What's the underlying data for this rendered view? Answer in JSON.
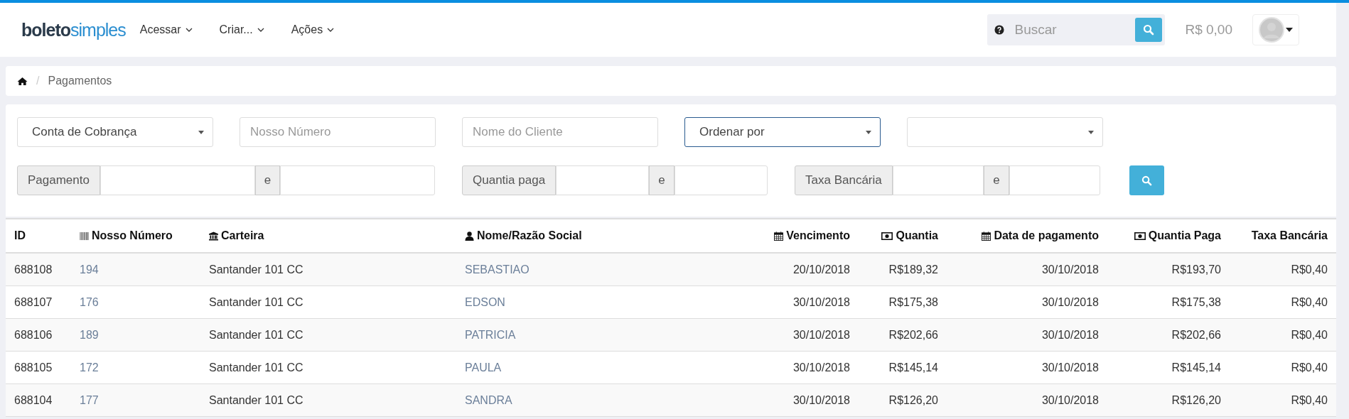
{
  "nav": {
    "logo": {
      "dark": "boleto",
      "light": "simples"
    },
    "menus": [
      {
        "label": "Acessar"
      },
      {
        "label": "Criar..."
      },
      {
        "label": "Ações"
      }
    ],
    "search": {
      "placeholder": "Buscar"
    },
    "balance": "R$ 0,00"
  },
  "breadcrumb": {
    "separator": "/",
    "items": [
      "Pagamentos"
    ]
  },
  "filters": {
    "fields": [
      {
        "kind": "select",
        "value": "Conta de Cobrança",
        "focused": false
      },
      {
        "kind": "text",
        "placeholder": "Nosso Número",
        "focused": false
      },
      {
        "kind": "text",
        "placeholder": "Nome do Cliente",
        "focused": false
      },
      {
        "kind": "select",
        "value": "Ordenar por",
        "focused": true
      },
      {
        "kind": "select",
        "focused": false
      }
    ],
    "ranges": [
      {
        "label": "Pagamento",
        "separator": "e"
      },
      {
        "label": "Quantia paga",
        "separator": "e"
      },
      {
        "label": "Taxa Bancária",
        "separator": "e"
      }
    ]
  },
  "table": {
    "columns": [
      {
        "label": "ID",
        "kind": "plain"
      },
      {
        "label": "Nosso Número",
        "kind": "barcode"
      },
      {
        "label": "Carteira",
        "kind": "bank"
      },
      {
        "label": "Nome/Razão Social",
        "kind": "user"
      },
      {
        "label": "Vencimento",
        "kind": "calendar"
      },
      {
        "label": "Quantia",
        "kind": "money"
      },
      {
        "label": "Data de pagamento",
        "kind": "calendar"
      },
      {
        "label": "Quantia Paga",
        "kind": "money"
      },
      {
        "label": "Taxa Bancária",
        "kind": "plain"
      }
    ],
    "rows": [
      [
        "688108",
        "194",
        "Santander 101 CC",
        "SEBASTIAO",
        "20/10/2018",
        "R$189,32",
        "30/10/2018",
        "R$193,70",
        "R$0,40"
      ],
      [
        "688107",
        "176",
        "Santander 101 CC",
        "EDSON",
        "30/10/2018",
        "R$175,38",
        "30/10/2018",
        "R$175,38",
        "R$0,40"
      ],
      [
        "688106",
        "189",
        "Santander 101 CC",
        "PATRICIA",
        "30/10/2018",
        "R$202,66",
        "30/10/2018",
        "R$202,66",
        "R$0,40"
      ],
      [
        "688105",
        "172",
        "Santander 101 CC",
        "PAULA",
        "30/10/2018",
        "R$145,14",
        "30/10/2018",
        "R$145,14",
        "R$0,40"
      ],
      [
        "688104",
        "177",
        "Santander 101 CC",
        "SANDRA",
        "30/10/2018",
        "R$126,20",
        "30/10/2018",
        "R$126,20",
        "R$0,40"
      ]
    ]
  }
}
